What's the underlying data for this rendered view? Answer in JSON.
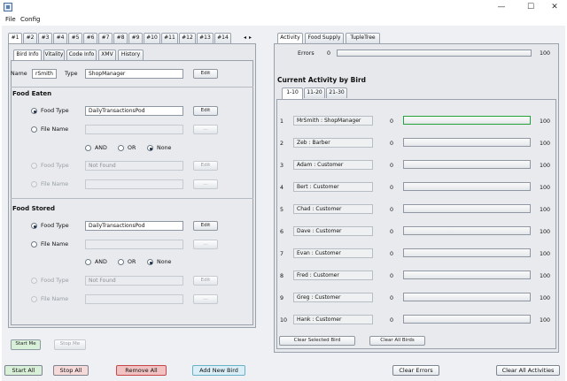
{
  "window": {
    "minimize": "—",
    "maximize": "☐",
    "close": "✕"
  },
  "menu": {
    "file": "File",
    "config": "Config"
  },
  "birds_tabs": [
    "#1",
    "#2",
    "#3",
    "#4",
    "#5",
    "#6",
    "#7",
    "#8",
    "#9",
    "#10",
    "#11",
    "#12",
    "#13",
    "#14"
  ],
  "scroll_arrows": {
    "left": "◂",
    "right": "▸"
  },
  "sub_tabs": [
    "Bird Info",
    "Vitality",
    "Code Info",
    "XMV",
    "History"
  ],
  "bird_info": {
    "name_label": "Name",
    "name_value": "rSmith",
    "type_label": "Type",
    "type_value": "ShopManager",
    "type_btn": "Edit"
  },
  "food_eaten": {
    "title": "Food Eaten",
    "food_type_label": "Food Type",
    "food_type_value": "DailyTransactionsPod",
    "food_type_btn": "Edit",
    "file_name_label": "File Name",
    "file_name_btn": "...",
    "and": "AND",
    "or": "OR",
    "none": "None",
    "food_type2_label": "Food Type",
    "food_type2_value": "Not Found",
    "food_type2_btn": "Edit",
    "file_name2_label": "File Name",
    "file_name2_btn": "..."
  },
  "food_stored": {
    "title": "Food Stored",
    "food_type_label": "Food Type",
    "food_type_value": "DailyTransactionsPod",
    "food_type_btn": "Edit",
    "file_name_label": "File Name",
    "file_name_btn": "...",
    "and": "AND",
    "or": "OR",
    "none": "None",
    "food_type2_label": "Food Type",
    "food_type2_value": "Not Found",
    "food_type2_btn": "Edit",
    "file_name2_label": "File Name",
    "file_name2_btn": "..."
  },
  "start_me": "Start Me",
  "stop_me": "Stop Me",
  "right_tabs": [
    "Activity",
    "Food Supply",
    "TupleTree"
  ],
  "errors": {
    "label": "Errors",
    "min": "0",
    "max": "100"
  },
  "activity": {
    "title": "Current Activity by Bird",
    "range_tabs": [
      "1-10",
      "11-20",
      "21-30"
    ],
    "rows": [
      {
        "num": "1",
        "name": "MrSmith : ShopManager",
        "min": "0",
        "max": "100"
      },
      {
        "num": "2",
        "name": "Zeb : Barber",
        "min": "0",
        "max": "100"
      },
      {
        "num": "3",
        "name": "Adam : Customer",
        "min": "0",
        "max": "100"
      },
      {
        "num": "4",
        "name": "Bert : Customer",
        "min": "0",
        "max": "100"
      },
      {
        "num": "5",
        "name": "Chad : Customer",
        "min": "0",
        "max": "100"
      },
      {
        "num": "6",
        "name": "Dave : Customer",
        "min": "0",
        "max": "100"
      },
      {
        "num": "7",
        "name": "Evan : Customer",
        "min": "0",
        "max": "100"
      },
      {
        "num": "8",
        "name": "Fred : Customer",
        "min": "0",
        "max": "100"
      },
      {
        "num": "9",
        "name": "Greg : Customer",
        "min": "0",
        "max": "100"
      },
      {
        "num": "10",
        "name": "Hank : Customer",
        "min": "0",
        "max": "100"
      }
    ],
    "clear_selected": "Clear Selected Bird",
    "clear_all_birds": "Clear All Birds"
  },
  "footer": {
    "start_all": "Start All",
    "stop_all": "Stop All",
    "remove_all": "Remove All",
    "add_new_bird": "Add New Bird",
    "clear_errors": "Clear Errors",
    "clear_all_activities": "Clear All Activities"
  },
  "colors": {
    "start": "#d8f0d8",
    "stop": "#f6dada",
    "remove": "#f2c2c2",
    "add": "#d9eef6",
    "highlight": "#23a23a"
  }
}
